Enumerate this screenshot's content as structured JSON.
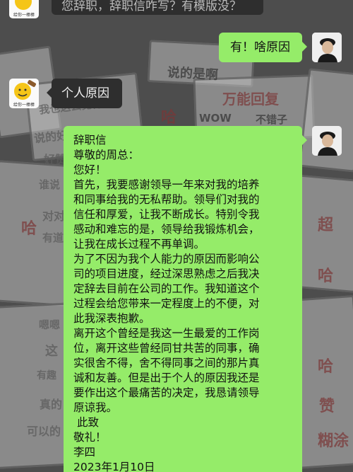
{
  "background": {
    "words": [
      "说的是啊",
      "万能回复",
      "WOW",
      "不错子",
      "哈",
      "我也这么觉得",
      "说的好",
      "好赞",
      "谁说",
      "对对",
      "哈",
      "有道",
      "嗯嗯",
      "这",
      "有趣",
      "真的",
      "可以的",
      "哈",
      "超",
      "赞",
      "哈",
      "糊涂"
    ]
  },
  "chat": {
    "bot_avatar_caption": "给你一棒棒",
    "partial_top_message": "您辞职，辞职信咋写？有模版没？",
    "user_message": "有！啥原因",
    "bot_reply": "个人原因",
    "letter": {
      "lines": [
        "辞职信",
        "尊敬的周总：",
        "您好！",
        "首先，我要感谢领导一年来对我的培养",
        "和同事给我的无私帮助。领导们对我的",
        "信任和厚爱，让我不断成长。特别令我",
        "感动和难忘的是，领导给我锻炼机会，",
        "让我在成长过程不再单调。",
        "为了不因为我个人能力的原因而影响公",
        "司的项目进度，经过深思熟虑之后我决",
        "定辞去目前在公司的工作。我知道这个",
        "过程会给您带来一定程度上的不便，对",
        "此我深表抱歉。",
        "离开这个曾经是我这一生最爱的工作岗",
        "位，离开这些曾经同甘共苦的同事，确",
        "实很舍不得，舍不得同事之间的那片真",
        "诚和友善。但是出于个人的原因我还是",
        "要作出这个最痛苦的决定，我恳请领导",
        "原谅我。",
        " 此致",
        "敬礼！",
        "李四",
        "2023年1月10日"
      ]
    }
  },
  "colors": {
    "green_bubble": "#95ec69",
    "dark_bubble": "#2e2e2e"
  },
  "icons": {
    "bot_avatar": "yellow-emoji-hammer-icon",
    "user_avatar": "person-cap-photo-icon"
  }
}
